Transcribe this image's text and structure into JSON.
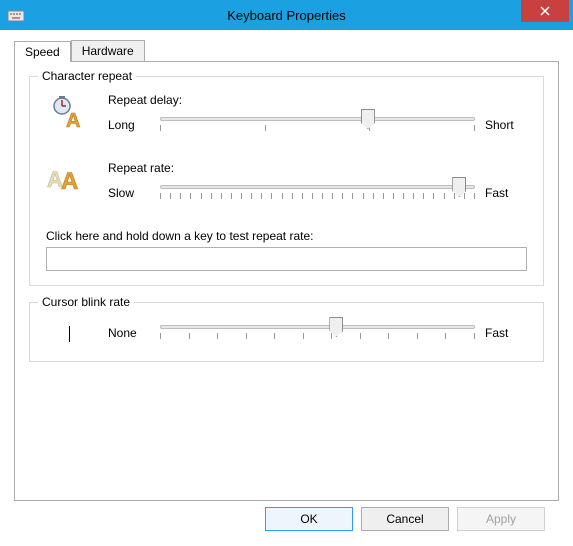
{
  "window": {
    "title": "Keyboard Properties"
  },
  "tabs": [
    {
      "label": "Speed",
      "active": true
    },
    {
      "label": "Hardware",
      "active": false
    }
  ],
  "char_group": {
    "legend": "Character repeat",
    "delay": {
      "label": "Repeat delay:",
      "left": "Long",
      "right": "Short",
      "value": 66
    },
    "rate": {
      "label": "Repeat rate:",
      "left": "Slow",
      "right": "Fast",
      "value": 95
    },
    "test_label": "Click here and hold down a key to test repeat rate:",
    "test_value": ""
  },
  "cursor_group": {
    "legend": "Cursor blink rate",
    "left": "None",
    "right": "Fast",
    "value": 56
  },
  "buttons": {
    "ok": "OK",
    "cancel": "Cancel",
    "apply": "Apply"
  }
}
